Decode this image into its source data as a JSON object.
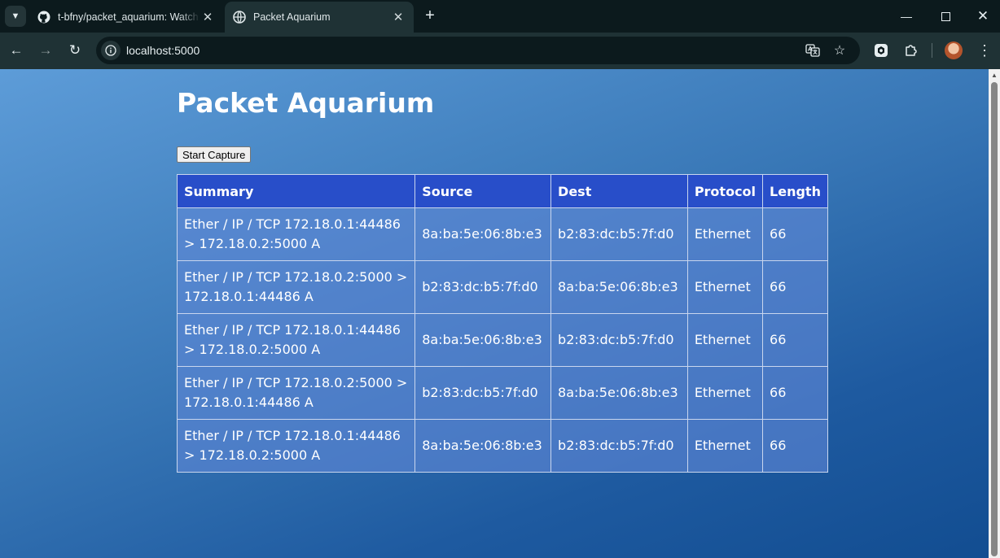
{
  "browser": {
    "tabs": [
      {
        "title": "t-bfny/packet_aquarium: Watch",
        "active": false,
        "icon": "github-icon"
      },
      {
        "title": "Packet Aquarium",
        "active": true,
        "icon": "globe-icon"
      }
    ],
    "address_bar": {
      "url": "localhost:5000"
    },
    "toolbar_icons": [
      "back-icon",
      "forward-icon",
      "reload-icon",
      "site-info-icon",
      "translate-icon",
      "star-icon",
      "extension-icon",
      "puzzle-icon",
      "avatar",
      "menu-icon"
    ]
  },
  "page": {
    "title": "Packet Aquarium",
    "capture_button": "Start Capture",
    "table": {
      "headers": [
        "Summary",
        "Source",
        "Dest",
        "Protocol",
        "Length"
      ],
      "rows": [
        [
          "Ether / IP / TCP 172.18.0.1:44486 > 172.18.0.2:5000 A",
          "8a:ba:5e:06:8b:e3",
          "b2:83:dc:b5:7f:d0",
          "Ethernet",
          "66"
        ],
        [
          "Ether / IP / TCP 172.18.0.2:5000 > 172.18.0.1:44486 A",
          "b2:83:dc:b5:7f:d0",
          "8a:ba:5e:06:8b:e3",
          "Ethernet",
          "66"
        ],
        [
          "Ether / IP / TCP 172.18.0.1:44486 > 172.18.0.2:5000 A",
          "8a:ba:5e:06:8b:e3",
          "b2:83:dc:b5:7f:d0",
          "Ethernet",
          "66"
        ],
        [
          "Ether / IP / TCP 172.18.0.2:5000 > 172.18.0.1:44486 A",
          "b2:83:dc:b5:7f:d0",
          "8a:ba:5e:06:8b:e3",
          "Ethernet",
          "66"
        ],
        [
          "Ether / IP / TCP 172.18.0.1:44486 > 172.18.0.2:5000 A",
          "8a:ba:5e:06:8b:e3",
          "b2:83:dc:b5:7f:d0",
          "Ethernet",
          "66"
        ]
      ]
    }
  },
  "colors": {
    "header_bg": "#284ec9",
    "cell_bg": "#5f87d7",
    "page_gradient_start": "#5d9cd8",
    "page_gradient_end": "#124d91"
  }
}
